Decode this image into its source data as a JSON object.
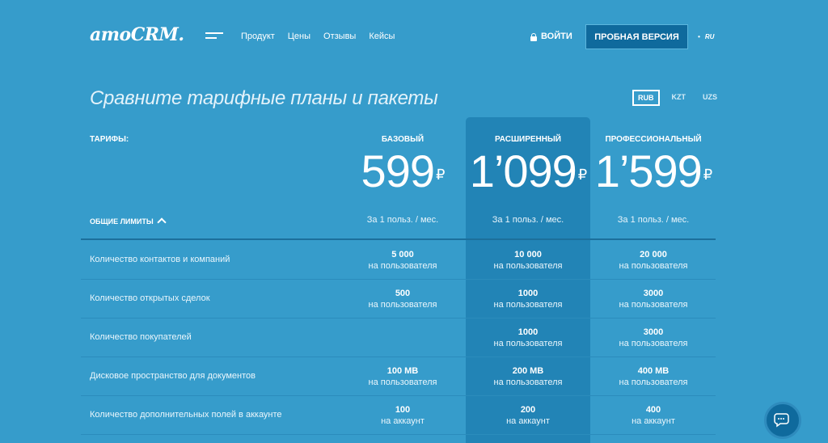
{
  "header": {
    "logo": "amoCRM.",
    "nav": [
      "Продукт",
      "Цены",
      "Отзывы",
      "Кейсы"
    ],
    "login": "ВОЙТИ",
    "trial": "ПРОБНАЯ ВЕРСИЯ",
    "lang": "RU"
  },
  "title": "Сравните тарифные планы и пакеты",
  "currencies": [
    "RUB",
    "KZT",
    "UZS"
  ],
  "active_currency": "RUB",
  "tariffs_label": "ТАРИФЫ:",
  "limits_label": "ОБЩИЕ ЛИМИТЫ",
  "currency_sign": "₽",
  "plans": [
    {
      "name": "БАЗОВЫЙ",
      "price": "599",
      "per": "За 1 польз. / мес."
    },
    {
      "name": "РАСШИРЕННЫЙ",
      "price": "1’099",
      "per": "За 1 польз. / мес."
    },
    {
      "name": "ПРОФЕССИОНАЛЬНЫЙ",
      "price": "1’599",
      "per": "За 1 польз. / мес."
    }
  ],
  "rows": [
    {
      "label": "Количество контактов и компаний",
      "cells": [
        {
          "v": "5 000",
          "u": "на пользователя"
        },
        {
          "v": "10 000",
          "u": "на пользователя"
        },
        {
          "v": "20 000",
          "u": "на пользователя"
        }
      ]
    },
    {
      "label": "Количество открытых сделок",
      "cells": [
        {
          "v": "500",
          "u": "на пользователя"
        },
        {
          "v": "1000",
          "u": "на пользователя"
        },
        {
          "v": "3000",
          "u": "на пользователя"
        }
      ]
    },
    {
      "label": "Количество покупателей",
      "cells": [
        {
          "v": "",
          "u": ""
        },
        {
          "v": "1000",
          "u": "на пользователя"
        },
        {
          "v": "3000",
          "u": "на пользователя"
        }
      ]
    },
    {
      "label": "Дисковое пространство для документов",
      "cells": [
        {
          "v": "100 MB",
          "u": "на пользователя"
        },
        {
          "v": "200 MB",
          "u": "на пользователя"
        },
        {
          "v": "400 MB",
          "u": "на пользователя"
        }
      ]
    },
    {
      "label": "Количество дополнительных полей в аккаунте",
      "cells": [
        {
          "v": "100",
          "u": "на аккаунт"
        },
        {
          "v": "200",
          "u": "на аккаунт"
        },
        {
          "v": "400",
          "u": "на аккаунт"
        }
      ]
    }
  ]
}
